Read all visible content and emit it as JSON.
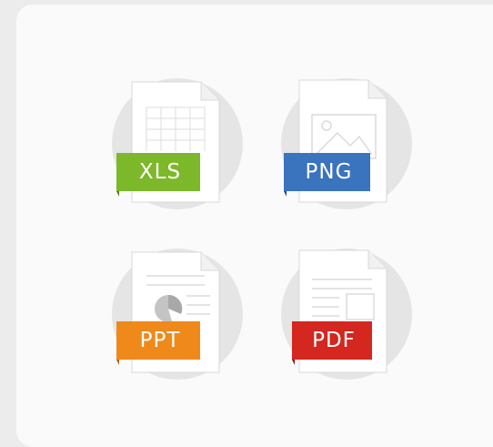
{
  "file_types": [
    {
      "label": "XLS",
      "color": "#7db82a",
      "fold": "#4f7a12",
      "icon": "spreadsheet-icon"
    },
    {
      "label": "PNG",
      "color": "#3a73be",
      "fold": "#234a80",
      "icon": "image-icon"
    },
    {
      "label": "PPT",
      "color": "#ef8a1a",
      "fold": "#a65a0b",
      "icon": "presentation-icon"
    },
    {
      "label": "PDF",
      "color": "#d3271f",
      "fold": "#861611",
      "icon": "pdf-document-icon"
    }
  ]
}
